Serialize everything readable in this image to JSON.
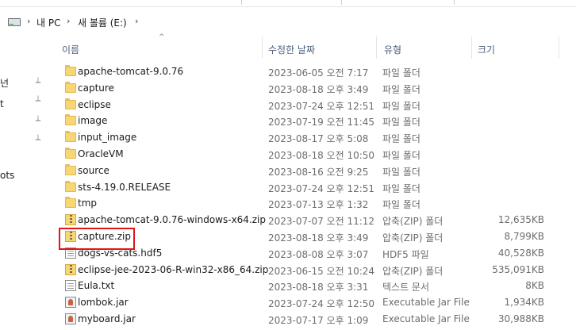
{
  "breadcrumb": {
    "items": [
      "내 PC",
      "새 볼륨 (E:)"
    ]
  },
  "nav": {
    "cut_labels": [
      "넌",
      "t",
      "ots"
    ]
  },
  "header": {
    "name": "이름",
    "date": "수정한 날짜",
    "type": "유형",
    "size": "크기"
  },
  "files": [
    {
      "name": "apache-tomcat-9.0.76",
      "date": "2023-06-05 오전 7:17",
      "type": "파일 폴더",
      "size": "",
      "icon": "folder-icon"
    },
    {
      "name": "capture",
      "date": "2023-08-18 오후 3:49",
      "type": "파일 폴더",
      "size": "",
      "icon": "folder-icon"
    },
    {
      "name": "eclipse",
      "date": "2023-07-24 오후 12:51",
      "type": "파일 폴더",
      "size": "",
      "icon": "folder-icon"
    },
    {
      "name": "image",
      "date": "2023-07-19 오전 11:45",
      "type": "파일 폴더",
      "size": "",
      "icon": "folder-icon"
    },
    {
      "name": "input_image",
      "date": "2023-08-17 오후 5:08",
      "type": "파일 폴더",
      "size": "",
      "icon": "folder-icon"
    },
    {
      "name": "OracleVM",
      "date": "2023-08-18 오전 10:50",
      "type": "파일 폴더",
      "size": "",
      "icon": "folder-icon"
    },
    {
      "name": "source",
      "date": "2023-08-16 오전 9:25",
      "type": "파일 폴더",
      "size": "",
      "icon": "folder-icon"
    },
    {
      "name": "sts-4.19.0.RELEASE",
      "date": "2023-07-24 오후 12:51",
      "type": "파일 폴더",
      "size": "",
      "icon": "folder-icon"
    },
    {
      "name": "tmp",
      "date": "2023-07-13 오후 1:32",
      "type": "파일 폴더",
      "size": "",
      "icon": "folder-icon"
    },
    {
      "name": "apache-tomcat-9.0.76-windows-x64.zip",
      "date": "2023-07-07 오전 11:12",
      "type": "압축(ZIP) 폴더",
      "size": "12,635KB",
      "icon": "zip-icon"
    },
    {
      "name": "capture.zip",
      "date": "2023-08-18 오후 3:49",
      "type": "압축(ZIP) 폴더",
      "size": "8,799KB",
      "icon": "zip-icon"
    },
    {
      "name": "dogs-vs-cats.hdf5",
      "date": "2023-08-08 오후 3:07",
      "type": "HDF5 파일",
      "size": "40,528KB",
      "icon": "document-icon"
    },
    {
      "name": "eclipse-jee-2023-06-R-win32-x86_64.zip",
      "date": "2023-06-15 오전 10:24",
      "type": "압축(ZIP) 폴더",
      "size": "535,091KB",
      "icon": "zip-icon"
    },
    {
      "name": "Eula.txt",
      "date": "2023-08-18 오후 3:31",
      "type": "텍스트 문서",
      "size": "8KB",
      "icon": "document-icon"
    },
    {
      "name": "lombok.jar",
      "date": "2023-07-24 오후 12:50",
      "type": "Executable Jar File",
      "size": "1,934KB",
      "icon": "jar-icon"
    },
    {
      "name": "myboard.jar",
      "date": "2023-07-17 오후 1:09",
      "type": "Executable Jar File",
      "size": "30,988KB",
      "icon": "jar-icon"
    }
  ],
  "colors": {
    "highlight": "#e01515",
    "folder": "#f7d674",
    "header_text": "#4c607a"
  }
}
